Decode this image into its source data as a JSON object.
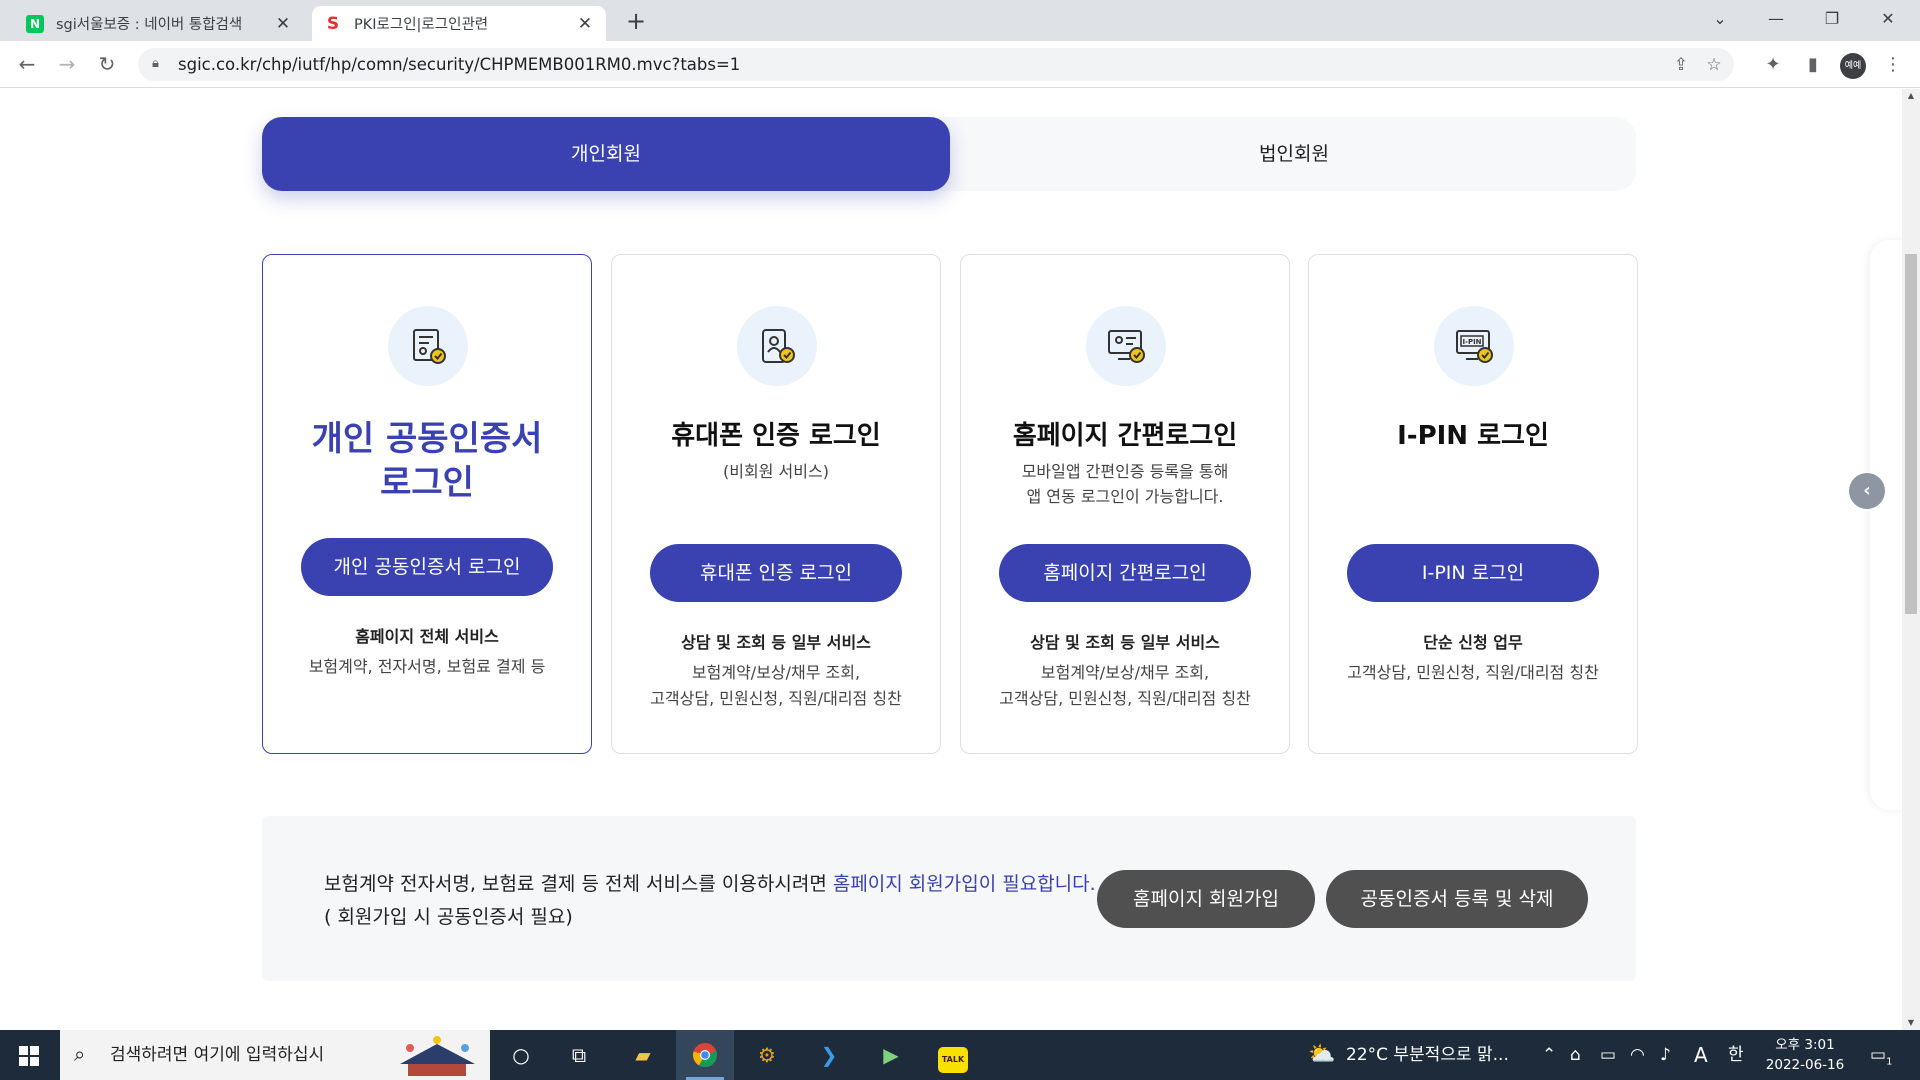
{
  "browser": {
    "tabs": [
      {
        "title": "sgi서울보증 : 네이버 통합검색",
        "favicon": "naver-icon"
      },
      {
        "title": "PKI로그인|로그인관련",
        "favicon": "sgi-icon"
      }
    ],
    "url": "sgic.co.kr/chp/iutf/hp/comn/security/CHPMEMB001RM0.mvc?tabs=1",
    "profile_label": "예예"
  },
  "member_tabs": [
    {
      "label": "개인회원",
      "selected": true
    },
    {
      "label": "법인회원",
      "selected": false
    }
  ],
  "cards": [
    {
      "title_line1": "개인 공동인증서",
      "title_line2": "로그인",
      "subtitle": "",
      "button": "개인 공동인증서 로그인",
      "service_head": "홈페이지 전체 서비스",
      "service_desc_1": "보험계약, 전자서명, 보험료 결제 등",
      "service_desc_2": "",
      "icon": "certificate-icon",
      "selected": true
    },
    {
      "title_line1": "휴대폰 인증 로그인",
      "subtitle_1": "(비회원 서비스)",
      "subtitle_2": "",
      "button": "휴대폰 인증 로그인",
      "service_head": "상담 및 조회 등 일부 서비스",
      "service_desc_1": "보험계약/보상/채무 조회,",
      "service_desc_2": "고객상담, 민원신청, 직원/대리점 칭찬",
      "icon": "mobile-auth-icon",
      "selected": false
    },
    {
      "title_line1": "홈페이지 간편로그인",
      "subtitle_1": "모바일앱 간편인증 등록을 통해",
      "subtitle_2": "앱 연동 로그인이 가능합니다.",
      "button": "홈페이지 간편로그인",
      "service_head": "상담 및 조회 등 일부 서비스",
      "service_desc_1": "보험계약/보상/채무 조회,",
      "service_desc_2": "고객상담, 민원신청, 직원/대리점 칭찬",
      "icon": "simple-login-icon",
      "selected": false
    },
    {
      "title_line1": "I-PIN 로그인",
      "subtitle_1": "",
      "subtitle_2": "",
      "button": "I-PIN 로그인",
      "service_head": "단순 신청 업무",
      "service_desc_1": "고객상담, 민원신청, 직원/대리점 칭찬",
      "service_desc_2": "",
      "icon": "ipin-icon",
      "icon_text": "I-PIN",
      "selected": false
    }
  ],
  "notice": {
    "text_before": "보험계약 전자서명, 보험료 결제 등 전체 서비스를 이용하시려면 ",
    "text_highlight": "홈페이지 회원가입이 필요합니다.",
    "text_line2": "( 회원가입 시 공동인증서 필요)",
    "button_signup": "홈페이지 회원가입",
    "button_cert": "공동인증서 등록 및 삭제"
  },
  "taskbar": {
    "search_placeholder": "검색하려면 여기에 입력하십시",
    "weather": "22°C  부분적으로 맑...",
    "ime_a": "A",
    "ime_han": "한",
    "time": "오후 3:01",
    "date": "2022-06-16",
    "notification_count": "1"
  },
  "colors": {
    "primary": "#3942b0",
    "dark_button": "#505050",
    "taskbar": "#1e2b3b"
  }
}
